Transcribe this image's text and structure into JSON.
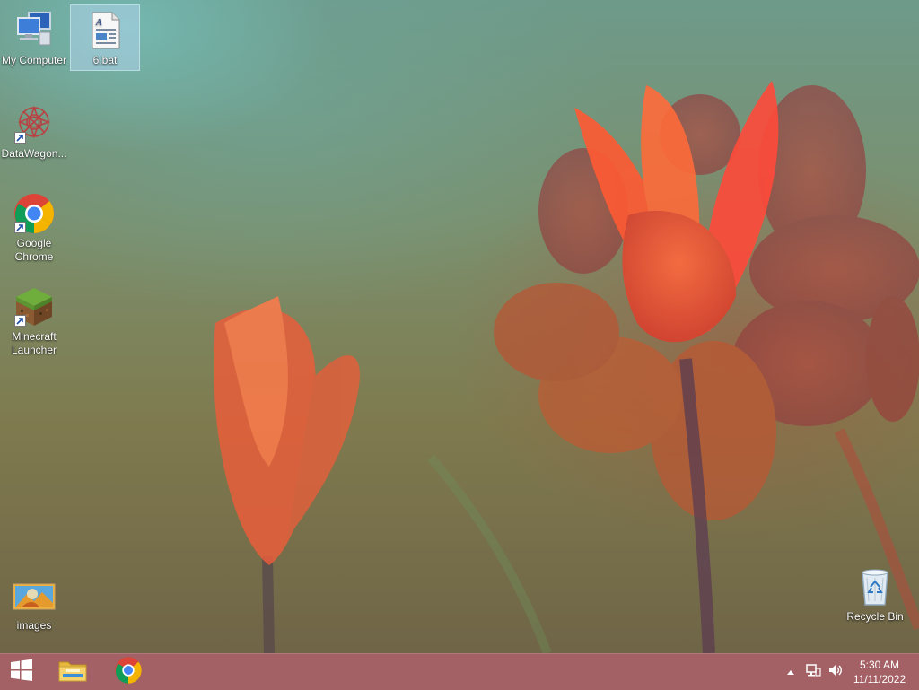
{
  "desktop": {
    "icons": [
      {
        "label": "My Computer",
        "icon": "computer-icon"
      },
      {
        "label": "6.bat",
        "icon": "batch-file-icon",
        "selected": true
      },
      {
        "label": "DataWagon...",
        "icon": "datawagon-icon"
      },
      {
        "label": "Google Chrome",
        "icon": "chrome-icon"
      },
      {
        "label": "Minecraft Launcher",
        "icon": "minecraft-icon"
      },
      {
        "label": "images",
        "icon": "images-folder-icon"
      },
      {
        "label": "Recycle Bin",
        "icon": "recycle-bin-icon"
      }
    ]
  },
  "taskbar": {
    "start": "windows-logo-icon",
    "pinned": [
      "file-explorer-icon",
      "chrome-icon"
    ],
    "tray": [
      "show-hidden-icons-icon",
      "network-icon",
      "volume-icon"
    ],
    "clock": {
      "time": "5:30 AM",
      "date": "11/11/2022"
    }
  },
  "colors": {
    "taskbar": "#9b5258",
    "selection": "#bedcfa"
  }
}
